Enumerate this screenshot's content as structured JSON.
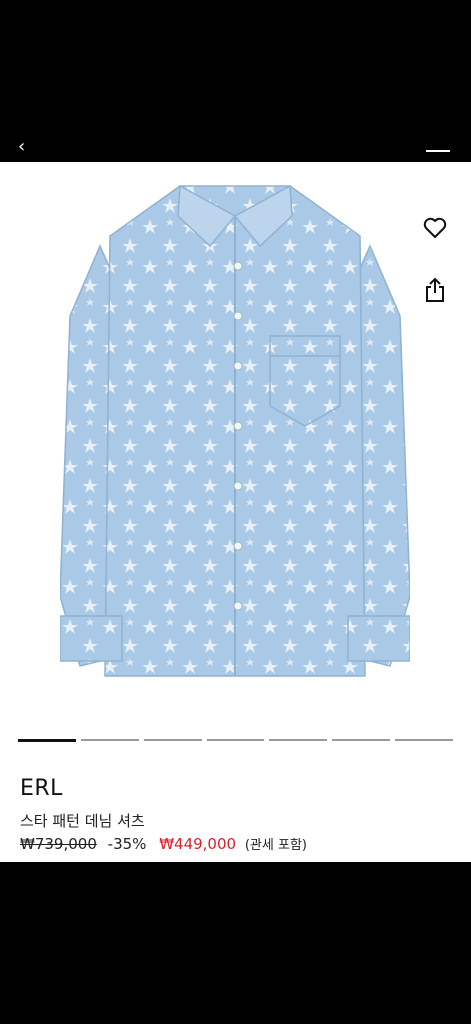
{
  "product": {
    "brand": "ERL",
    "title": "스타 패턴 데님 셔츠",
    "original_price": "₩739,000",
    "discount": "-35%",
    "sale_price": "₩449,000",
    "tax_note": "(관세 포함)"
  },
  "carousel": {
    "count": 7,
    "active": 0
  },
  "icons": {
    "back": "back-arrow-icon",
    "menu": "menu-icon",
    "wishlist": "heart-icon",
    "share": "share-icon"
  },
  "colors": {
    "sale": "#d8222a",
    "denim": "#a9c9e6",
    "star": "#e8f0f7"
  }
}
